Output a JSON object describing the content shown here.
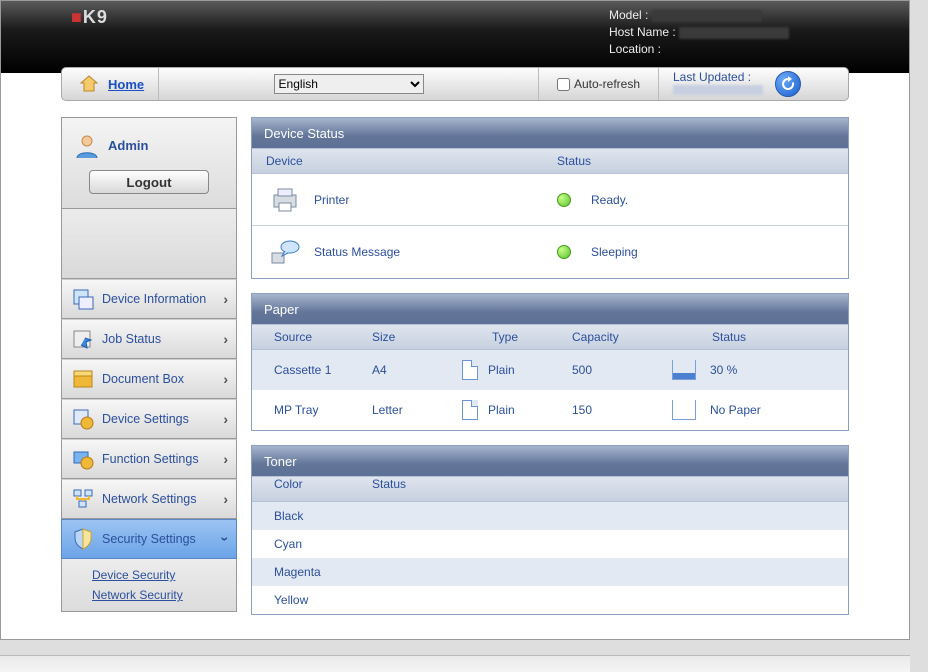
{
  "header": {
    "brand_prefix": "",
    "brand_suffix": "K9",
    "meta": {
      "model_label": "Model :",
      "host_label": "Host Name :",
      "location_label": "Location :"
    }
  },
  "topbar": {
    "home": "Home",
    "language_selected": "English",
    "auto_refresh": "Auto-refresh",
    "last_updated_label": "Last Updated :"
  },
  "user": {
    "name": "Admin",
    "logout": "Logout"
  },
  "nav": {
    "items": [
      "Device Information",
      "Job Status",
      "Document Box",
      "Device Settings",
      "Function Settings",
      "Network Settings",
      "Security Settings"
    ],
    "security_sub": [
      "Device Security",
      "Network Security"
    ]
  },
  "device_status": {
    "title": "Device Status",
    "col_device": "Device",
    "col_status": "Status",
    "rows": [
      {
        "name": "Printer",
        "status": "Ready."
      },
      {
        "name": "Status Message",
        "status": "Sleeping"
      }
    ]
  },
  "paper": {
    "title": "Paper",
    "cols": {
      "source": "Source",
      "size": "Size",
      "type": "Type",
      "capacity": "Capacity",
      "status": "Status"
    },
    "rows": [
      {
        "source": "Cassette 1",
        "size": "A4",
        "type": "Plain",
        "capacity": "500",
        "status": "30 %"
      },
      {
        "source": "MP Tray",
        "size": "Letter",
        "type": "Plain",
        "capacity": "150",
        "status": "No Paper"
      }
    ]
  },
  "toner": {
    "title": "Toner",
    "cols": {
      "color": "Color",
      "status": "Status"
    },
    "rows": [
      "Black",
      "Cyan",
      "Magenta",
      "Yellow"
    ]
  }
}
